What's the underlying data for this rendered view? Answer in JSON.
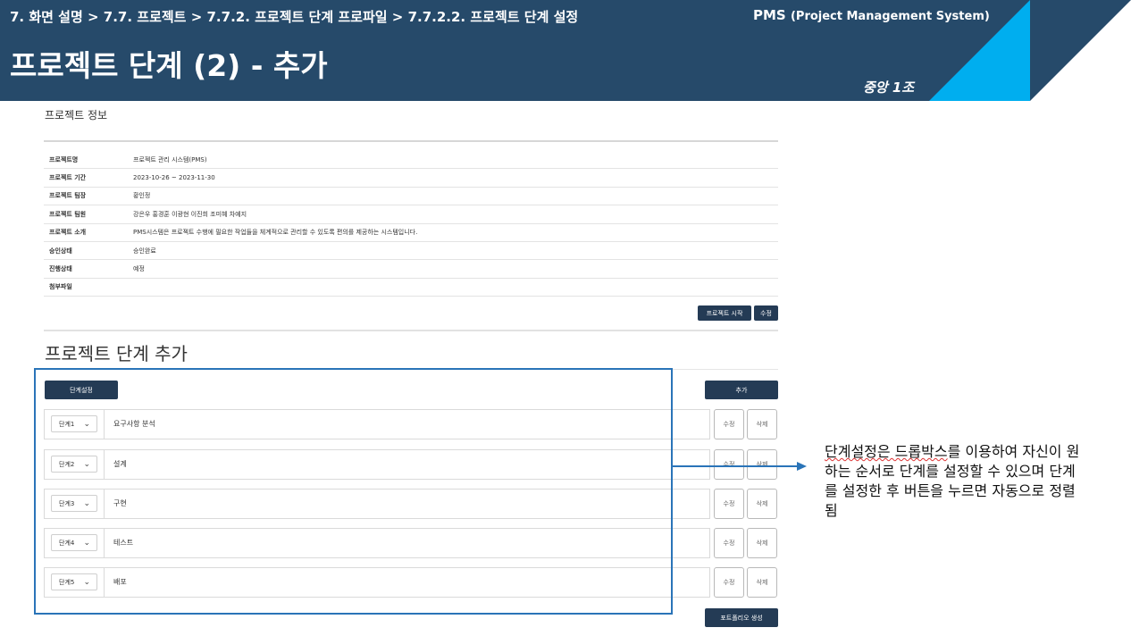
{
  "header": {
    "breadcrumb": "7. 화면 설명 > 7.7. 프로젝트 > 7.7.2. 프로젝트 단계 프로파일 > 7.7.2.2. 프로젝트 단계 설정",
    "system_name": "PMS",
    "system_name_full": "(Project Management System)",
    "slide_title": "프로젝트 단계 (2) - 추가",
    "team": "중앙 1조"
  },
  "project_info": {
    "section_title": "프로젝트 정보",
    "rows": [
      {
        "label": "프로젝트명",
        "value": "프로젝트 관리 시스템(PMS)"
      },
      {
        "label": "프로젝트 기간",
        "value": "2023-10-26 ~ 2023-11-30"
      },
      {
        "label": "프로젝트 팀장",
        "value": "황인정"
      },
      {
        "label": "프로젝트 팀원",
        "value": "강은우 홍경훈 이광현 이진희 조미혜 차예지"
      },
      {
        "label": "프로젝트 소개",
        "value": "PMS시스템은 프로젝트 수행에 필요한 작업들을 체계적으로 관리할 수 있도록 편의를 제공하는 시스템입니다."
      },
      {
        "label": "승인상태",
        "value": "승인완료"
      },
      {
        "label": "진행상태",
        "value": "예정"
      },
      {
        "label": "첨부파일",
        "value": ""
      }
    ],
    "start_button": "프로젝트 시작",
    "edit_button": "수정"
  },
  "stage_section": {
    "title": "프로젝트 단계 추가",
    "setting_button": "단계설정",
    "add_button": "추가",
    "stages": [
      {
        "order": "단계1",
        "name": "요구사항 분석",
        "edit": "수정",
        "delete": "삭제"
      },
      {
        "order": "단계2",
        "name": "설계",
        "edit": "수정",
        "delete": "삭제"
      },
      {
        "order": "단계3",
        "name": "구현",
        "edit": "수정",
        "delete": "삭제"
      },
      {
        "order": "단계4",
        "name": "테스트",
        "edit": "수정",
        "delete": "삭제"
      },
      {
        "order": "단계5",
        "name": "배포",
        "edit": "수정",
        "delete": "삭제"
      }
    ],
    "portfolio_button": "포트폴리오 생성"
  },
  "annotation": {
    "underlined": "단계설정은 드롭박스",
    "rest": "를 이용하여 자신이 원하는 순서로 단계를 설정할 수 있으며 단계를 설정한 후 버튼을 누르면 자동으로 정렬됨"
  },
  "colors": {
    "banner": "#264a6a",
    "accent_cyan": "#00aeef",
    "button_dark": "#243b55",
    "highlight_border": "#2a74b8"
  }
}
